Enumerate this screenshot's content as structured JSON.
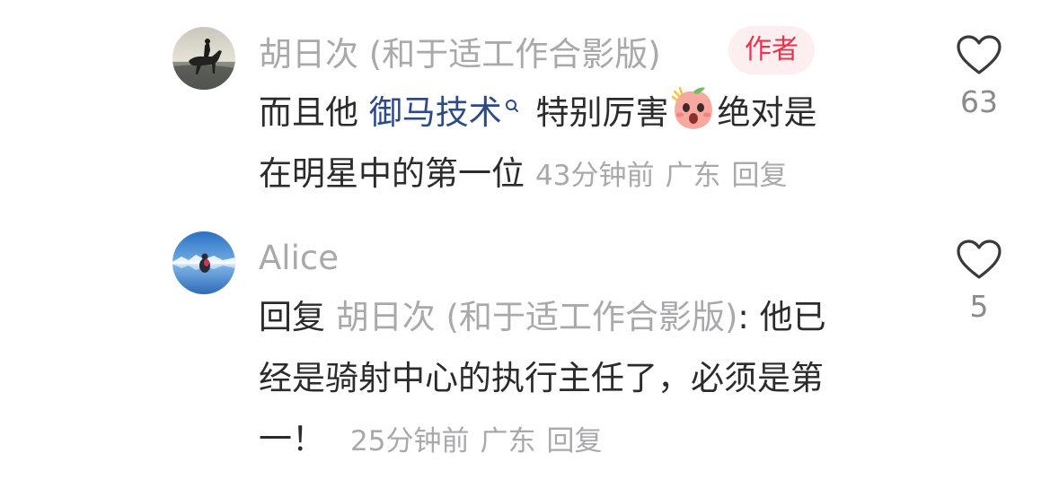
{
  "comments": [
    {
      "username": "胡日次 (和于适工作合影版)",
      "badge": "作者",
      "text_before": "而且他 ",
      "link_text": "御马技术",
      "text_after": " 特别厉害",
      "emoji": "shocked-peach-emoji",
      "text_line2_start": "绝对是",
      "text_line2": "在明星中的第一位",
      "time": "43分钟前",
      "location": "广东",
      "reply_label": "回复",
      "like_count": "63"
    },
    {
      "username": "Alice",
      "reply_prefix": "回复 ",
      "mention": "胡日次 (和于适工作合影版)",
      "colon_text": ": 他已",
      "text_line2": "经是骑射中心的执行主任了，必须是第",
      "text_line3": "一！",
      "time": "25分钟前",
      "location": "广东",
      "reply_label": "回复",
      "like_count": "5"
    }
  ],
  "colors": {
    "link": "#2c4a85",
    "badge_text": "#e8334f",
    "badge_bg": "#fdeef0",
    "muted": "#a9a9ab"
  },
  "icons": [
    "heart-outline-icon",
    "search-icon"
  ]
}
